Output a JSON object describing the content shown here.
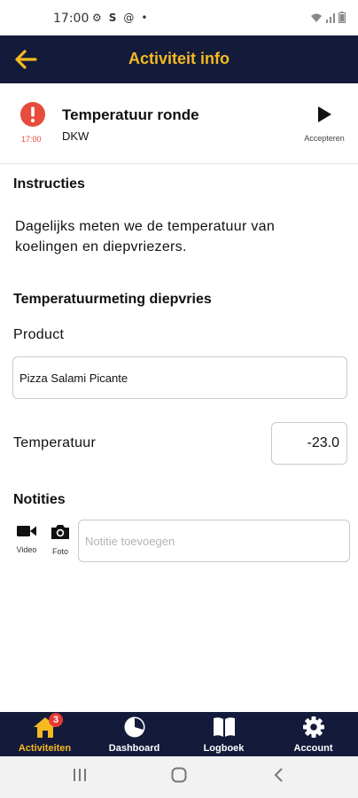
{
  "status_bar": {
    "time": "17:00",
    "left_icons": [
      "gear-icon",
      "s-icon",
      "at-icon",
      "dot-icon"
    ],
    "right_icons": [
      "wifi-icon",
      "signal-icon",
      "battery-icon"
    ]
  },
  "app_bar": {
    "title": "Activiteit info"
  },
  "activity": {
    "name": "Temperatuur ronde",
    "location": "DKW",
    "time": "17:00",
    "accept_label": "Accepteren"
  },
  "instructions": {
    "heading": "Instructies",
    "text": "Dagelijks meten we de temperatuur van koelingen en diepvriezers."
  },
  "measurement": {
    "heading": "Temperatuurmeting diepvries",
    "product_label": "Product",
    "product_value": "Pizza Salami Picante",
    "temperature_label": "Temperatuur",
    "temperature_value": "-23.0"
  },
  "notes": {
    "heading": "Notities",
    "video_label": "Video",
    "photo_label": "Foto",
    "placeholder": "Notitie toevoegen"
  },
  "bottom_nav": {
    "tabs": [
      {
        "label": "Activiteiten",
        "icon": "home-icon",
        "badge": "3",
        "active": true
      },
      {
        "label": "Dashboard",
        "icon": "pie-chart-icon"
      },
      {
        "label": "Logboek",
        "icon": "book-icon"
      },
      {
        "label": "Account",
        "icon": "gear-icon"
      }
    ]
  },
  "colors": {
    "navy": "#141b3a",
    "accent": "#f5b921",
    "alert": "#e74c3c",
    "badge": "#e53935"
  }
}
